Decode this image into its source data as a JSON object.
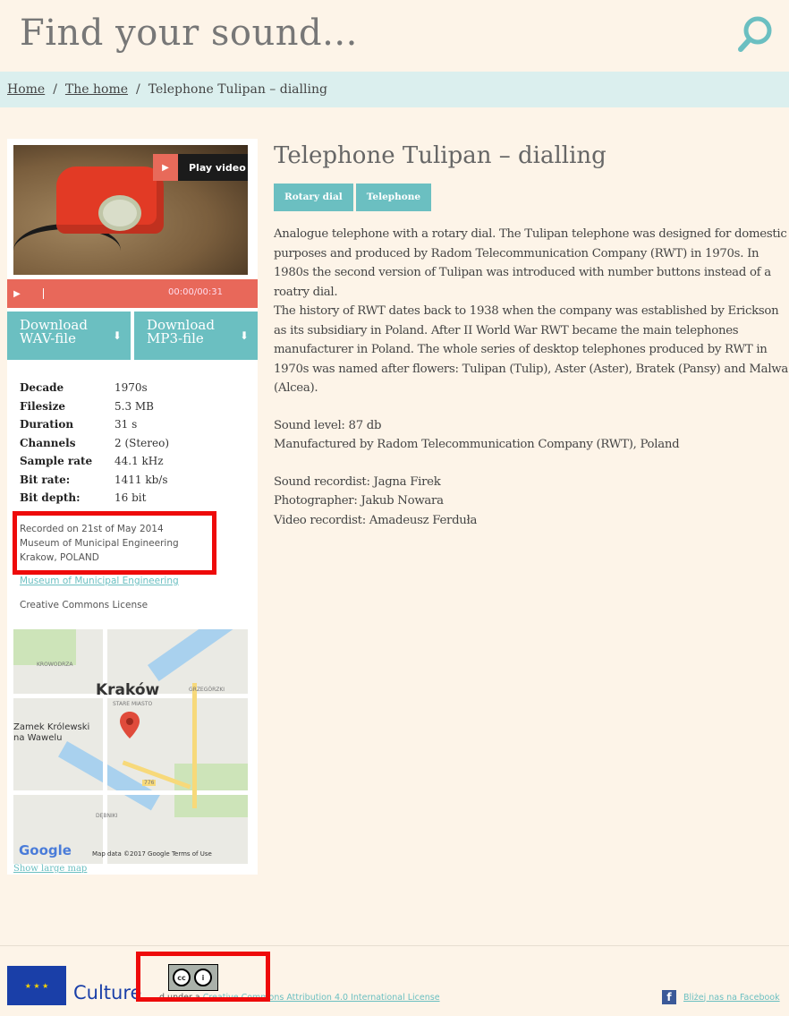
{
  "header": {
    "site_title": "Find your sound...",
    "search_icon": "search-icon"
  },
  "breadcrumb": {
    "items": [
      "Home",
      "The home",
      "Telephone Tulipan – dialling"
    ],
    "separator": "/"
  },
  "sidebar": {
    "video": {
      "play_label": "Play video"
    },
    "player": {
      "time": "00:00/00:31",
      "progress": 0
    },
    "downloads": [
      {
        "line1": "Download",
        "line2": "WAV-file"
      },
      {
        "line1": "Download",
        "line2": "MP3-file"
      }
    ],
    "metadata": [
      {
        "key": "Decade",
        "value": "1970s"
      },
      {
        "key": "Filesize",
        "value": "5.3 MB"
      },
      {
        "key": "Duration",
        "value": "31 s"
      },
      {
        "key": "Channels",
        "value": "2 (Stereo)"
      },
      {
        "key": "Sample rate",
        "value": "44.1 kHz"
      },
      {
        "key": "Bit rate:",
        "value": "1411 kb/s"
      },
      {
        "key": "Bit depth:",
        "value": "16 bit"
      }
    ],
    "recorded": {
      "line1": "Recorded on 21st of May 2014",
      "line2": "Museum of Municipal Engineering",
      "line3": "Krakow, POLAND"
    },
    "museum_link": "Museum of Municipal Engineering",
    "license": "Creative Commons License",
    "map": {
      "city": "Kraków",
      "label_castle": "Zamek Królewski\nna Wawelu",
      "google": "Google",
      "attribution": "Map data ©2017 Google   Terms of Use",
      "road_number": "776"
    },
    "show_larger_map": "Show large map"
  },
  "main": {
    "title": "Telephone Tulipan – dialling",
    "tags": [
      "Rotary dial",
      "Telephone"
    ],
    "paragraph1": "Analogue telephone with a rotary dial. The Tulipan telephone was designed for domestic purposes and produced by Radom Telecommunication Company (RWT) in 1970s. In 1980s the second version of Tulipan was introduced with number buttons instead of a roatry dial.\nThe history of RWT dates back to 1938 when the company was established by Erickson as its subsidiary in Poland. After II World War RWT became the main telephones manufacturer in Poland. The whole series of desktop telephones produced by RWT in 1970s was named after flowers: Tulipan (Tulip), Aster (Aster), Bratek (Pansy) and Malwa (Alcea).",
    "paragraph2": "Sound level: 87 db\nManufactured by Radom Telecommunication Company (RWT), Poland",
    "paragraph3": "Sound recordist: Jagna Firek\nPhotographer: Jakub Nowara\nVideo recordist: Amadeusz Ferduła"
  },
  "footer": {
    "culture": "Culture",
    "license_prefix": "d under a",
    "license_link": "Creative Commons Attribution 4.0 International License",
    "facebook_link": "Bliżej nas na Facebook"
  },
  "colors": {
    "teal": "#6bbfc1",
    "coral": "#e8685a",
    "background": "#fdf4e8",
    "highlight": "#ee0a0a"
  }
}
